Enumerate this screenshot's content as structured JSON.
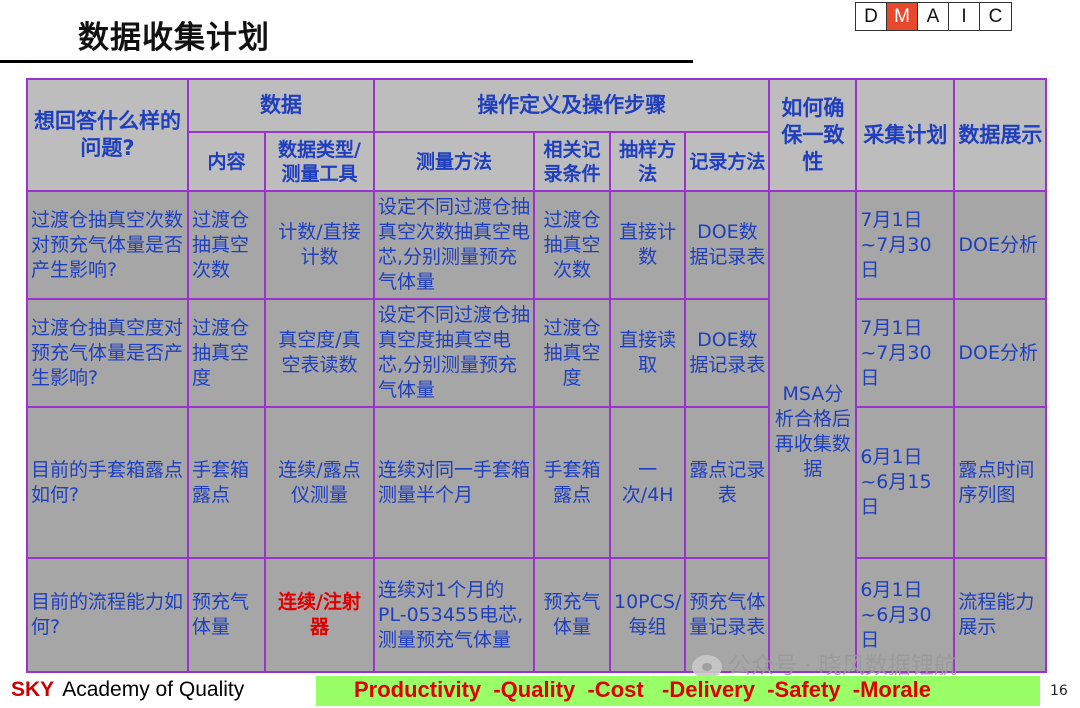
{
  "title": "数据收集计划",
  "dmaic": [
    {
      "letter": "D",
      "active": false
    },
    {
      "letter": "M",
      "active": true
    },
    {
      "letter": "A",
      "active": false
    },
    {
      "letter": "I",
      "active": false
    },
    {
      "letter": "C",
      "active": false
    }
  ],
  "header": {
    "question": "想回答什么样的问题?",
    "data_group": "数据",
    "content": "内容",
    "data_type": "数据类型/测量工具",
    "ops_group": "操作定义及操作步骤",
    "method": "测量方法",
    "conditions": "相关记录条件",
    "sampling": "抽样方法",
    "record": "记录方法",
    "consistency": "如何确保一致性",
    "plan": "采集计划",
    "display": "数据展示"
  },
  "rows": [
    {
      "question": "过渡仓抽真空次数对预充气体量是否产生影响?",
      "content": "过渡仓抽真空次数",
      "data_type": "计数/直接计数",
      "method": "设定不同过渡仓抽真空次数抽真空电芯,分别测量预充气体量",
      "conditions": "过渡仓抽真空次数",
      "sampling": "直接计数",
      "record": "DOE数据记录表",
      "plan": "7月1日~7月30日",
      "display": "DOE分析"
    },
    {
      "question": "过渡仓抽真空度对预充气体量是否产生影响?",
      "content": "过渡仓抽真空度",
      "data_type": "真空度/真空表读数",
      "method": "设定不同过渡仓抽真空度抽真空电芯,分别测量预充气体量",
      "conditions": "过渡仓抽真空度",
      "sampling": "直接读取",
      "record": "DOE数据记录表",
      "plan": "7月1日~7月30日",
      "display": "DOE分析"
    },
    {
      "question": "目前的手套箱露点如何?",
      "content": "手套箱露点",
      "data_type": "连续/露点仪测量",
      "method": "连续对同一手套箱测量半个月",
      "conditions": "手套箱露点",
      "sampling": "一次/4H",
      "record": "露点记录表",
      "plan": "6月1日~6月15日",
      "display": "露点时间序列图"
    },
    {
      "question": "目前的流程能力如何?",
      "content": "预充气体量",
      "data_type": "连续/注射器",
      "method": "连续对1个月的PL-053455电芯,测量预充气体量",
      "conditions": "预充气体量",
      "sampling": "10PCS/每组",
      "record": "预充气体量记录表",
      "plan": "6月1日~6月30日",
      "display": "流程能力展示"
    }
  ],
  "consistency_value": "MSA分析合格后再收集数据",
  "footer": {
    "brand": "SKY",
    "org": "Academy of Quality",
    "slogan": "Productivity  -Quality  -Cost   -Delivery  -Safety  -Morale",
    "page": "16"
  },
  "watermark": "公众号 · 晓风数据锂航",
  "colors": {
    "accent": "#e8492c",
    "table_border": "#9933cc",
    "cell_text": "#1f3fbf",
    "slogan_bg": "#99ff66"
  }
}
